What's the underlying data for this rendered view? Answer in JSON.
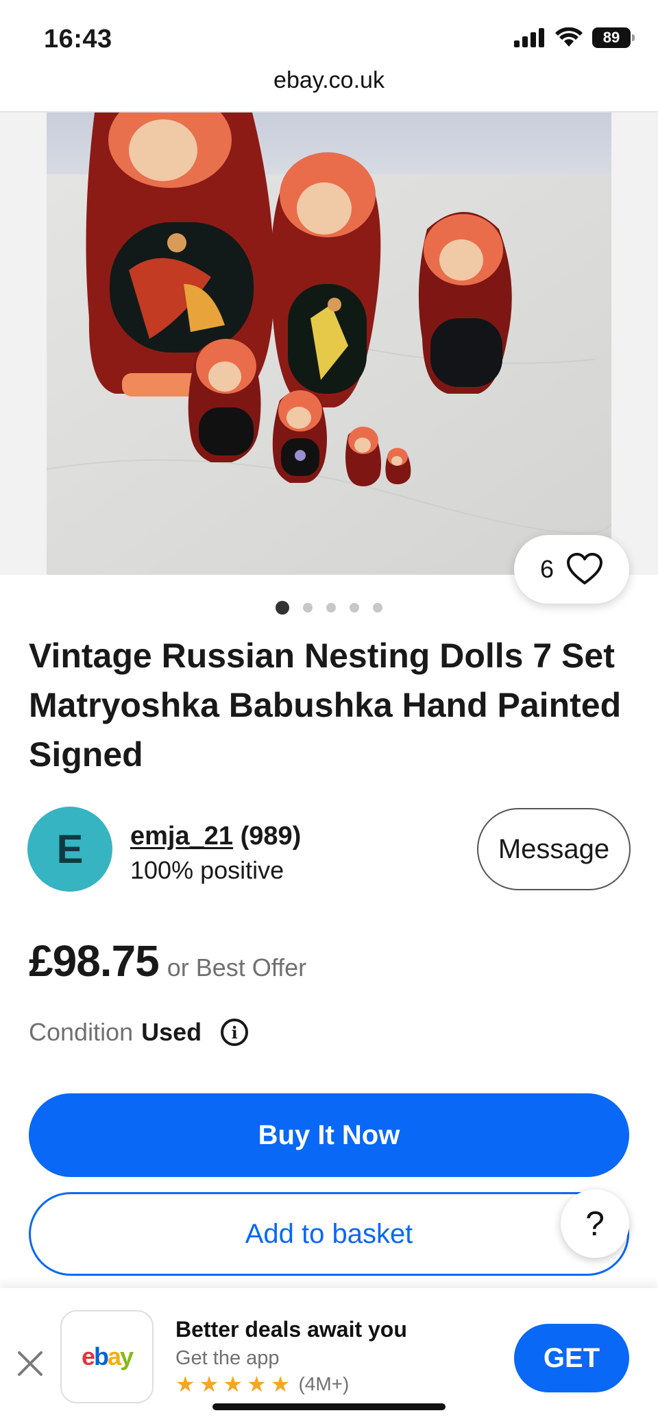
{
  "status_bar": {
    "time": "16:43",
    "battery": "89",
    "icons": [
      "signal-icon",
      "wifi-icon",
      "battery-icon"
    ]
  },
  "browser": {
    "url": "ebay.co.uk"
  },
  "gallery": {
    "image_count": 5,
    "active_index": 0,
    "watch_count": "6",
    "icon": "heart-icon"
  },
  "listing": {
    "title": "Vintage Russian Nesting Dolls 7 Set Matryoshka Babushka Hand Painted Signed",
    "price": "£98.75",
    "offer_text": "or Best Offer",
    "condition_label": "Condition",
    "condition_value": "Used",
    "condition_info_icon": "info-icon"
  },
  "seller": {
    "avatar_letter": "E",
    "avatar_color": "#36b4c1",
    "name": "emja_21",
    "score": "(989)",
    "feedback": "100% positive",
    "message_label": "Message"
  },
  "actions": {
    "buy_label": "Buy It Now",
    "basket_label": "Add to basket",
    "help_label": "?",
    "accent_color": "#0968f6"
  },
  "app_banner": {
    "title": "Better deals await you",
    "subtitle": "Get the app",
    "rating_count": "(4M+)",
    "stars": 5,
    "get_label": "GET",
    "close_icon": "close-icon"
  }
}
